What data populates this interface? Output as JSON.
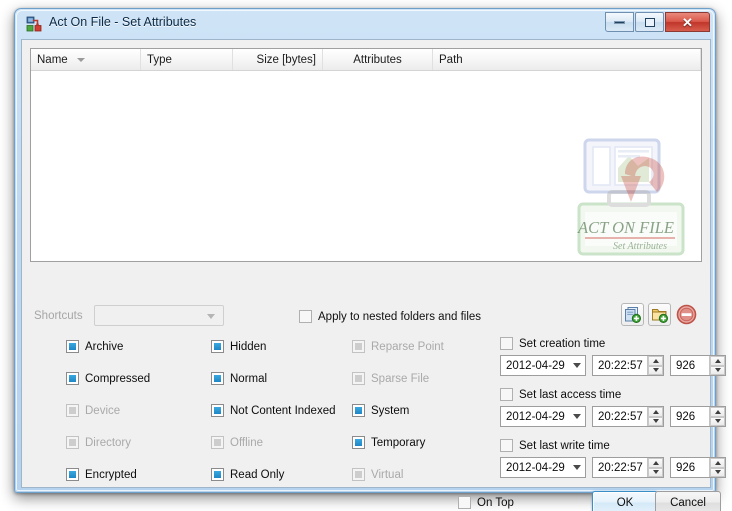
{
  "window": {
    "title": "Act On File - Set Attributes",
    "icon": "act-on-file-icon",
    "minimize_label": "Minimize",
    "maximize_label": "Maximize",
    "close_label": "Close"
  },
  "file_list": {
    "columns": [
      {
        "label": "Name",
        "sorted": true
      },
      {
        "label": "Type",
        "sorted": false
      },
      {
        "label": "Size [bytes]",
        "sorted": false
      },
      {
        "label": "Attributes",
        "sorted": false
      },
      {
        "label": "Path",
        "sorted": false
      }
    ],
    "rows": [],
    "watermark_line1": "ACT ON FILE",
    "watermark_line2": "Set Attributes"
  },
  "shortcuts": {
    "label": "Shortcuts",
    "value": "",
    "placeholder": "",
    "disabled": true
  },
  "apply_nested": {
    "label": "Apply to nested folders and files",
    "checked": false
  },
  "toolbar": {
    "buttons": [
      {
        "name": "add-files-button",
        "icon": "add-file-icon"
      },
      {
        "name": "add-folder-button",
        "icon": "add-folder-icon"
      },
      {
        "name": "remove-button",
        "icon": "remove-circle-icon"
      }
    ]
  },
  "attributes": {
    "column1": [
      {
        "label": "Archive",
        "state": "partial",
        "disabled": false
      },
      {
        "label": "Compressed",
        "state": "partial",
        "disabled": false
      },
      {
        "label": "Device",
        "state": "partial",
        "disabled": true
      },
      {
        "label": "Directory",
        "state": "partial",
        "disabled": true
      },
      {
        "label": "Encrypted",
        "state": "partial",
        "disabled": false
      }
    ],
    "column2": [
      {
        "label": "Hidden",
        "state": "partial",
        "disabled": false
      },
      {
        "label": "Normal",
        "state": "partial",
        "disabled": false
      },
      {
        "label": "Not Content Indexed",
        "state": "partial",
        "disabled": false
      },
      {
        "label": "Offline",
        "state": "partial",
        "disabled": true
      },
      {
        "label": "Read Only",
        "state": "partial",
        "disabled": false
      }
    ],
    "column3": [
      {
        "label": "Reparse Point",
        "state": "partial",
        "disabled": true
      },
      {
        "label": "Sparse File",
        "state": "partial",
        "disabled": true
      },
      {
        "label": "System",
        "state": "partial",
        "disabled": false
      },
      {
        "label": "Temporary",
        "state": "partial",
        "disabled": false
      },
      {
        "label": "Virtual",
        "state": "partial",
        "disabled": true
      }
    ]
  },
  "times": [
    {
      "check_label": "Set creation time",
      "checked": false,
      "date": "2012-04-29",
      "time": "20:22:57",
      "ms": "926"
    },
    {
      "check_label": "Set last access time",
      "checked": false,
      "date": "2012-04-29",
      "time": "20:22:57",
      "ms": "926"
    },
    {
      "check_label": "Set last write time",
      "checked": false,
      "date": "2012-04-29",
      "time": "20:22:57",
      "ms": "926"
    }
  ],
  "footer": {
    "on_top_label": "On Top",
    "on_top_checked": false,
    "ok_label": "OK",
    "cancel_label": "Cancel"
  },
  "colors": {
    "accent_blue": "#2b8ec9",
    "title_gradient_top": "#cfe4f6",
    "close_red": "#c8392b",
    "client_bg": "#f0f0f0"
  }
}
